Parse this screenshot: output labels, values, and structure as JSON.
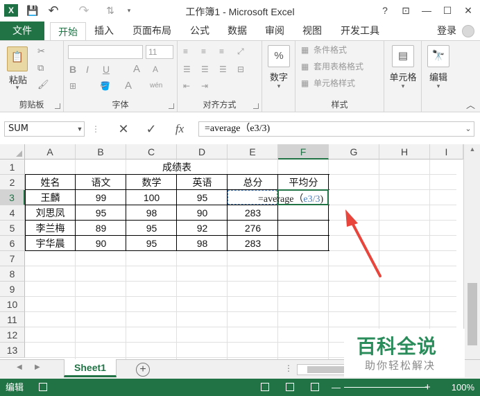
{
  "window": {
    "title": "工作簿1 - Microsoft Excel",
    "help": "?",
    "restore_ribbon": "⊡",
    "minimize": "—",
    "maximize": "☐",
    "close": "✕"
  },
  "qat": {
    "save": "💾",
    "undo": "↶",
    "redo": "↷",
    "more": "⇅"
  },
  "tabs": {
    "file": "文件",
    "items": [
      "开始",
      "插入",
      "页面布局",
      "公式",
      "数据",
      "审阅",
      "视图",
      "开发工具"
    ],
    "active": "开始",
    "login": "登录"
  },
  "ribbon": {
    "clipboard": {
      "paste": "粘贴",
      "label": "剪贴板"
    },
    "font": {
      "size": "11",
      "bold": "B",
      "italic": "I",
      "underline": "U",
      "grow": "A",
      "shrink": "A",
      "wen": "wén",
      "label": "字体"
    },
    "alignment": {
      "label": "对齐方式"
    },
    "number": {
      "percent": "%",
      "label_btn": "数字"
    },
    "styles": {
      "conditional": "条件格式",
      "table": "套用表格格式",
      "cell": "单元格样式",
      "label": "样式"
    },
    "cells": {
      "label": "单元格"
    },
    "editing": {
      "label": "编辑"
    }
  },
  "formula_bar": {
    "name_box": "SUM",
    "cancel": "✕",
    "enter": "✓",
    "fx": "fx",
    "formula": "=average（e3/3)"
  },
  "sheet": {
    "columns": [
      "A",
      "B",
      "C",
      "D",
      "E",
      "F",
      "G",
      "H",
      "I"
    ],
    "rows": [
      "1",
      "2",
      "3",
      "4",
      "5",
      "6",
      "7",
      "8",
      "9",
      "10",
      "11",
      "12",
      "13"
    ],
    "table_title": "成绩表",
    "headers": [
      "姓名",
      "语文",
      "数学",
      "英语",
      "总分",
      "平均分"
    ],
    "data": [
      [
        "王麟",
        "99",
        "100",
        "95",
        "",
        ""
      ],
      [
        "刘思凤",
        "95",
        "98",
        "90",
        "283",
        ""
      ],
      [
        "李兰梅",
        "89",
        "95",
        "92",
        "276",
        ""
      ],
      [
        "宇华晨",
        "90",
        "95",
        "98",
        "283",
        ""
      ]
    ],
    "editing_prefix": "=average（",
    "editing_ref": "e3/3",
    "editing_suffix": ")"
  },
  "sheet_tabs": {
    "active": "Sheet1",
    "add": "+"
  },
  "status": {
    "mode": "编辑",
    "zoom": "100%",
    "minus": "—",
    "plus": "+"
  },
  "watermark": {
    "title": "百科全说",
    "subtitle": "助你轻松解决"
  },
  "colors": {
    "excel_green": "#217346",
    "annotation": "#e8453c",
    "ref_blue": "#4a7ebb"
  }
}
